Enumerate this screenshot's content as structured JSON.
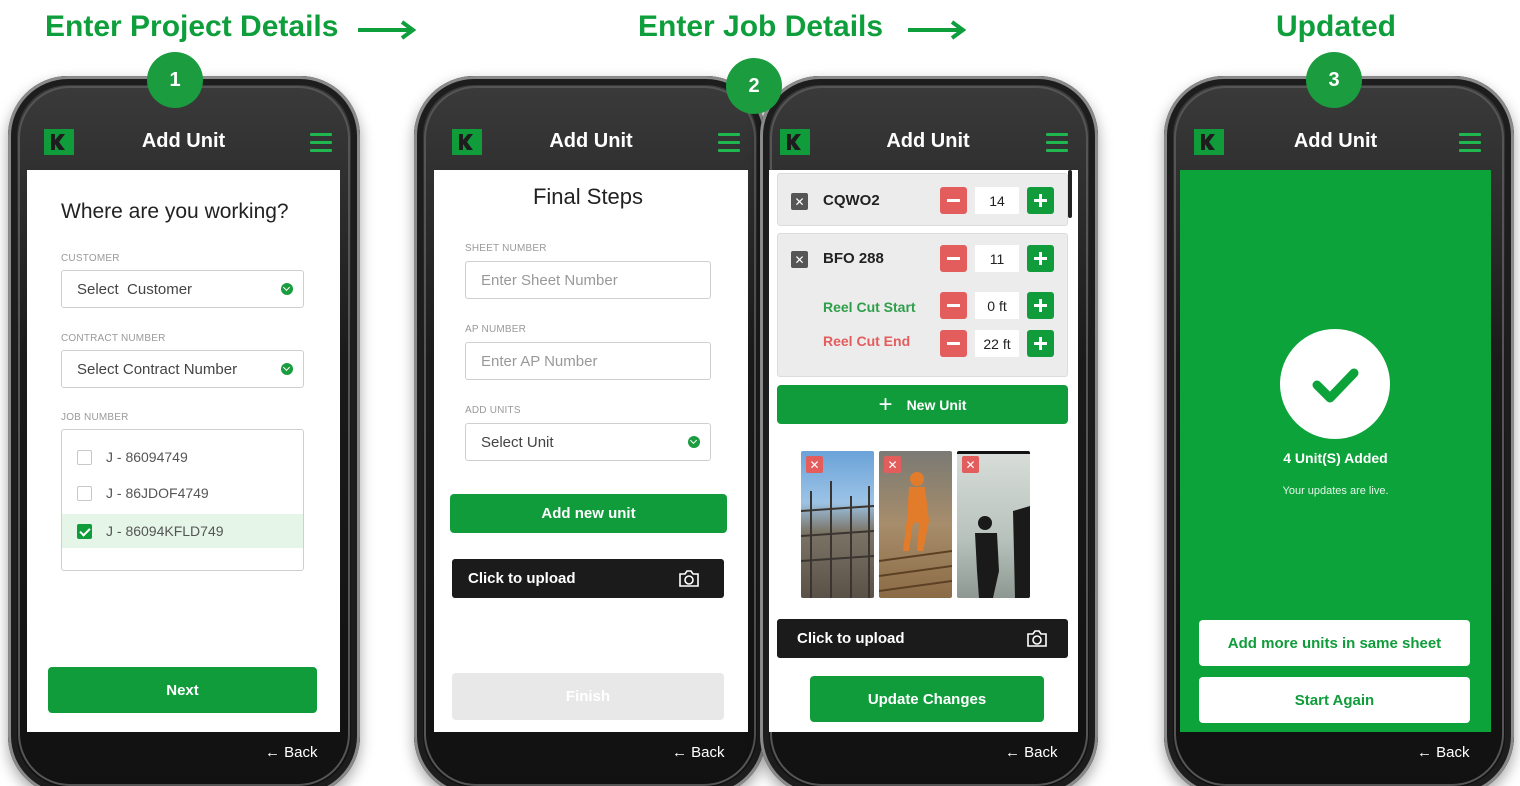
{
  "steps": [
    {
      "title": "Enter Project Details",
      "number": "1"
    },
    {
      "title": "Enter Job Details",
      "number": "2"
    },
    {
      "title": "Updated",
      "number": "3"
    }
  ],
  "app": {
    "header_title": "Add Unit",
    "back_label": "← Back",
    "accent": "#0e9f3c",
    "danger": "#e35d5d",
    "icons": {
      "logo": "brand-logo-icon",
      "menu": "hamburger-menu-icon",
      "camera": "camera-icon",
      "check": "check-icon",
      "remove": "close-icon",
      "decrease": "minus-icon",
      "increase": "plus-icon",
      "arrow": "arrow-right-icon"
    }
  },
  "screen1": {
    "heading": "Where are you working?",
    "customer_label": "CUSTOMER",
    "customer_value": "Select  Customer",
    "contract_label": "CONTRACT NUMBER",
    "contract_value": "Select Contract Number",
    "job_label": "JOB NUMBER",
    "jobs": [
      {
        "label": "J - 86094749",
        "checked": false
      },
      {
        "label": "J - 86JDOF4749",
        "checked": false
      },
      {
        "label": "J - 86094KFLD749",
        "checked": true
      }
    ],
    "next_label": "Next"
  },
  "screen2": {
    "heading": "Final Steps",
    "sheet_label": "SHEET NUMBER",
    "sheet_placeholder": "Enter Sheet Number",
    "ap_label": "AP NUMBER",
    "ap_placeholder": "Enter AP Number",
    "units_label": "ADD UNITS",
    "units_value": "Select Unit",
    "add_new_label": "Add new unit",
    "upload_label": "Click to upload",
    "finish_label": "Finish"
  },
  "screen3": {
    "units": [
      {
        "name": "CQWO2",
        "qty": "14"
      },
      {
        "name": "BFO 288",
        "qty": "11"
      }
    ],
    "reel_start_label": "Reel Cut Start",
    "reel_start_value": "0 ft",
    "reel_end_label": "Reel Cut End",
    "reel_end_value": "22 ft",
    "new_unit_label": "New Unit",
    "upload_label": "Click to upload",
    "update_label": "Update Changes"
  },
  "screen4": {
    "added_text": "4 Unit(S) Added",
    "live_text": "Your updates are live.",
    "more_label": "Add more units in same sheet",
    "again_label": "Start Again"
  }
}
